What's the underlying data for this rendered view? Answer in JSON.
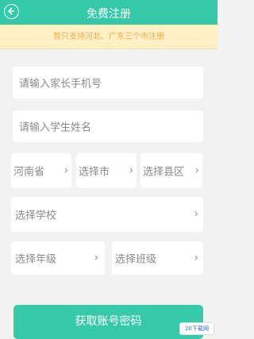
{
  "header": {
    "title": "免费注册"
  },
  "notice": {
    "text": "暂只支持河北、广东三个市注册"
  },
  "form": {
    "parent_phone_placeholder": "请输入家长手机号",
    "student_name_placeholder": "请输入学生姓名",
    "province": "河南省",
    "city": "选择市",
    "county": "选择县区",
    "school": "选择学校",
    "grade": "选择年级",
    "class": "选择班级"
  },
  "submit_label": "获取账号密码",
  "watermark": {
    "text": "20下载网"
  },
  "colors": {
    "accent": "#33c9a9",
    "notice_bg": "#fff1c4",
    "notice_text": "#f0aa4b"
  },
  "icons": {
    "back": "back-arrow-icon",
    "chevron": "chevron-right-icon"
  }
}
